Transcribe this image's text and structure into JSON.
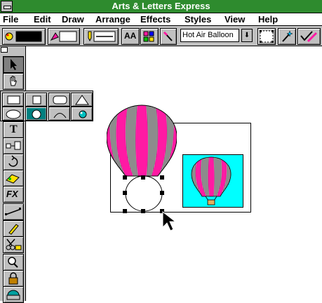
{
  "window": {
    "title": "Arts & Letters Express"
  },
  "menu": [
    "File",
    "Edit",
    "Draw",
    "Arrange",
    "Effects",
    "Styles",
    "View",
    "Help"
  ],
  "toolbar": {
    "font_name": "Hot Air Balloon",
    "text_style_label": "AA",
    "icons": [
      "fill-color-icon",
      "line-style-icon",
      "pen-icon",
      "text-style-icon",
      "node-edit-icon",
      "knife-icon",
      "symbol-icon",
      "snap-icon",
      "wand-icon",
      "check-pen-icon"
    ]
  },
  "palette": {
    "text_tool_label": "T",
    "fx_label": "FX"
  },
  "colors": {
    "title_bar": "#2e8b2e",
    "chrome": "#c0c0c0",
    "balloon_pink": "#ff1aa3",
    "balloon_gray": "#8c8c8c",
    "preview_bg": "#00ffff",
    "selected_tool": "#008080"
  }
}
